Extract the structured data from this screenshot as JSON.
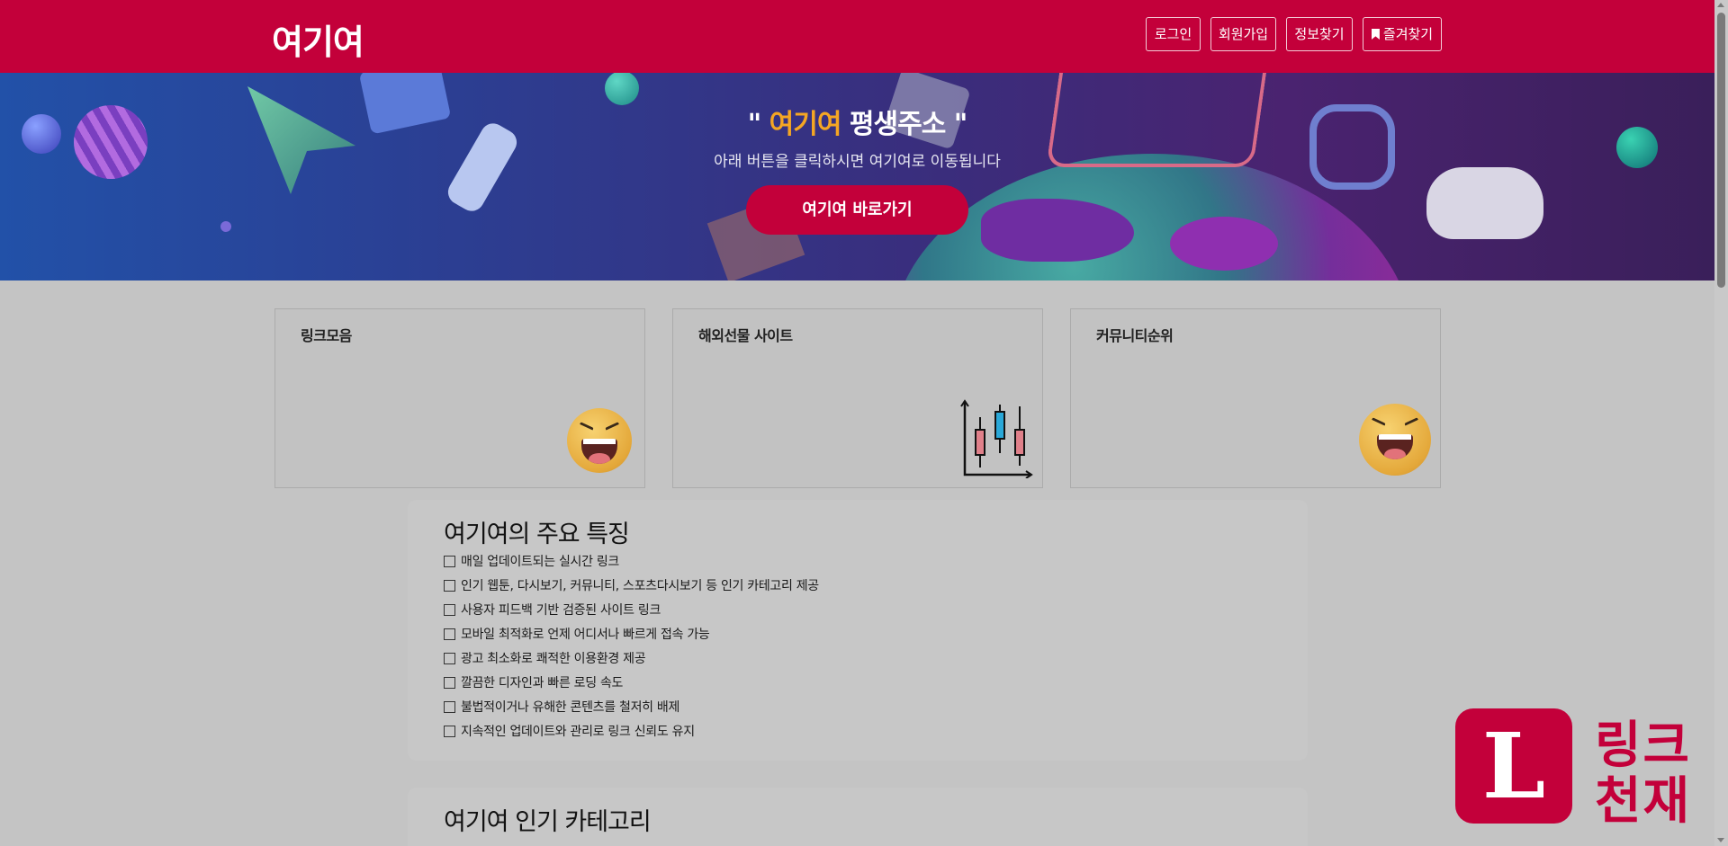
{
  "header": {
    "logo": "여기여",
    "nav": [
      {
        "label": "로그인"
      },
      {
        "label": "회원가입"
      },
      {
        "label": "정보찾기"
      },
      {
        "label": "즐겨찾기",
        "icon": "bookmark-icon"
      }
    ]
  },
  "hero": {
    "title_quote_open": "\"",
    "title_highlight": "여기여",
    "title_rest": "평생주소",
    "title_quote_close": "\"",
    "subtitle": "아래 버튼을 클릭하시면 여기여로 이동됩니다",
    "button_label": "여기여 바로가기"
  },
  "cards": [
    {
      "title": "링크모음",
      "icon": "laughing-emoji-icon"
    },
    {
      "title": "해외선물 사이트",
      "icon": "candlestick-chart-icon"
    },
    {
      "title": "커뮤니티순위",
      "icon": "laughing-emoji-icon"
    }
  ],
  "features": {
    "title": "여기여의 주요 특징",
    "items": [
      "매일 업데이트되는 실시간 링크",
      "인기 웹툰, 다시보기, 커뮤니티, 스포츠다시보기 등 인기 카테고리 제공",
      "사용자 피드백 기반 검증된 사이트 링크",
      "모바일 최적화로 언제 어디서나 빠르게 접속 가능",
      "광고 최소화로 쾌적한 이용환경 제공",
      "깔끔한 디자인과 빠른 로딩 속도",
      "불법적이거나 유해한 콘텐츠를 철저히 배제",
      "지속적인 업데이트와 관리로 링크 신뢰도 유지"
    ]
  },
  "categories": {
    "title": "여기여 인기 카테고리"
  },
  "watermark": {
    "letter": "L",
    "line1": "링크",
    "line2": "천재"
  },
  "colors": {
    "brand": "#c3003a",
    "highlight": "#f5a623"
  }
}
